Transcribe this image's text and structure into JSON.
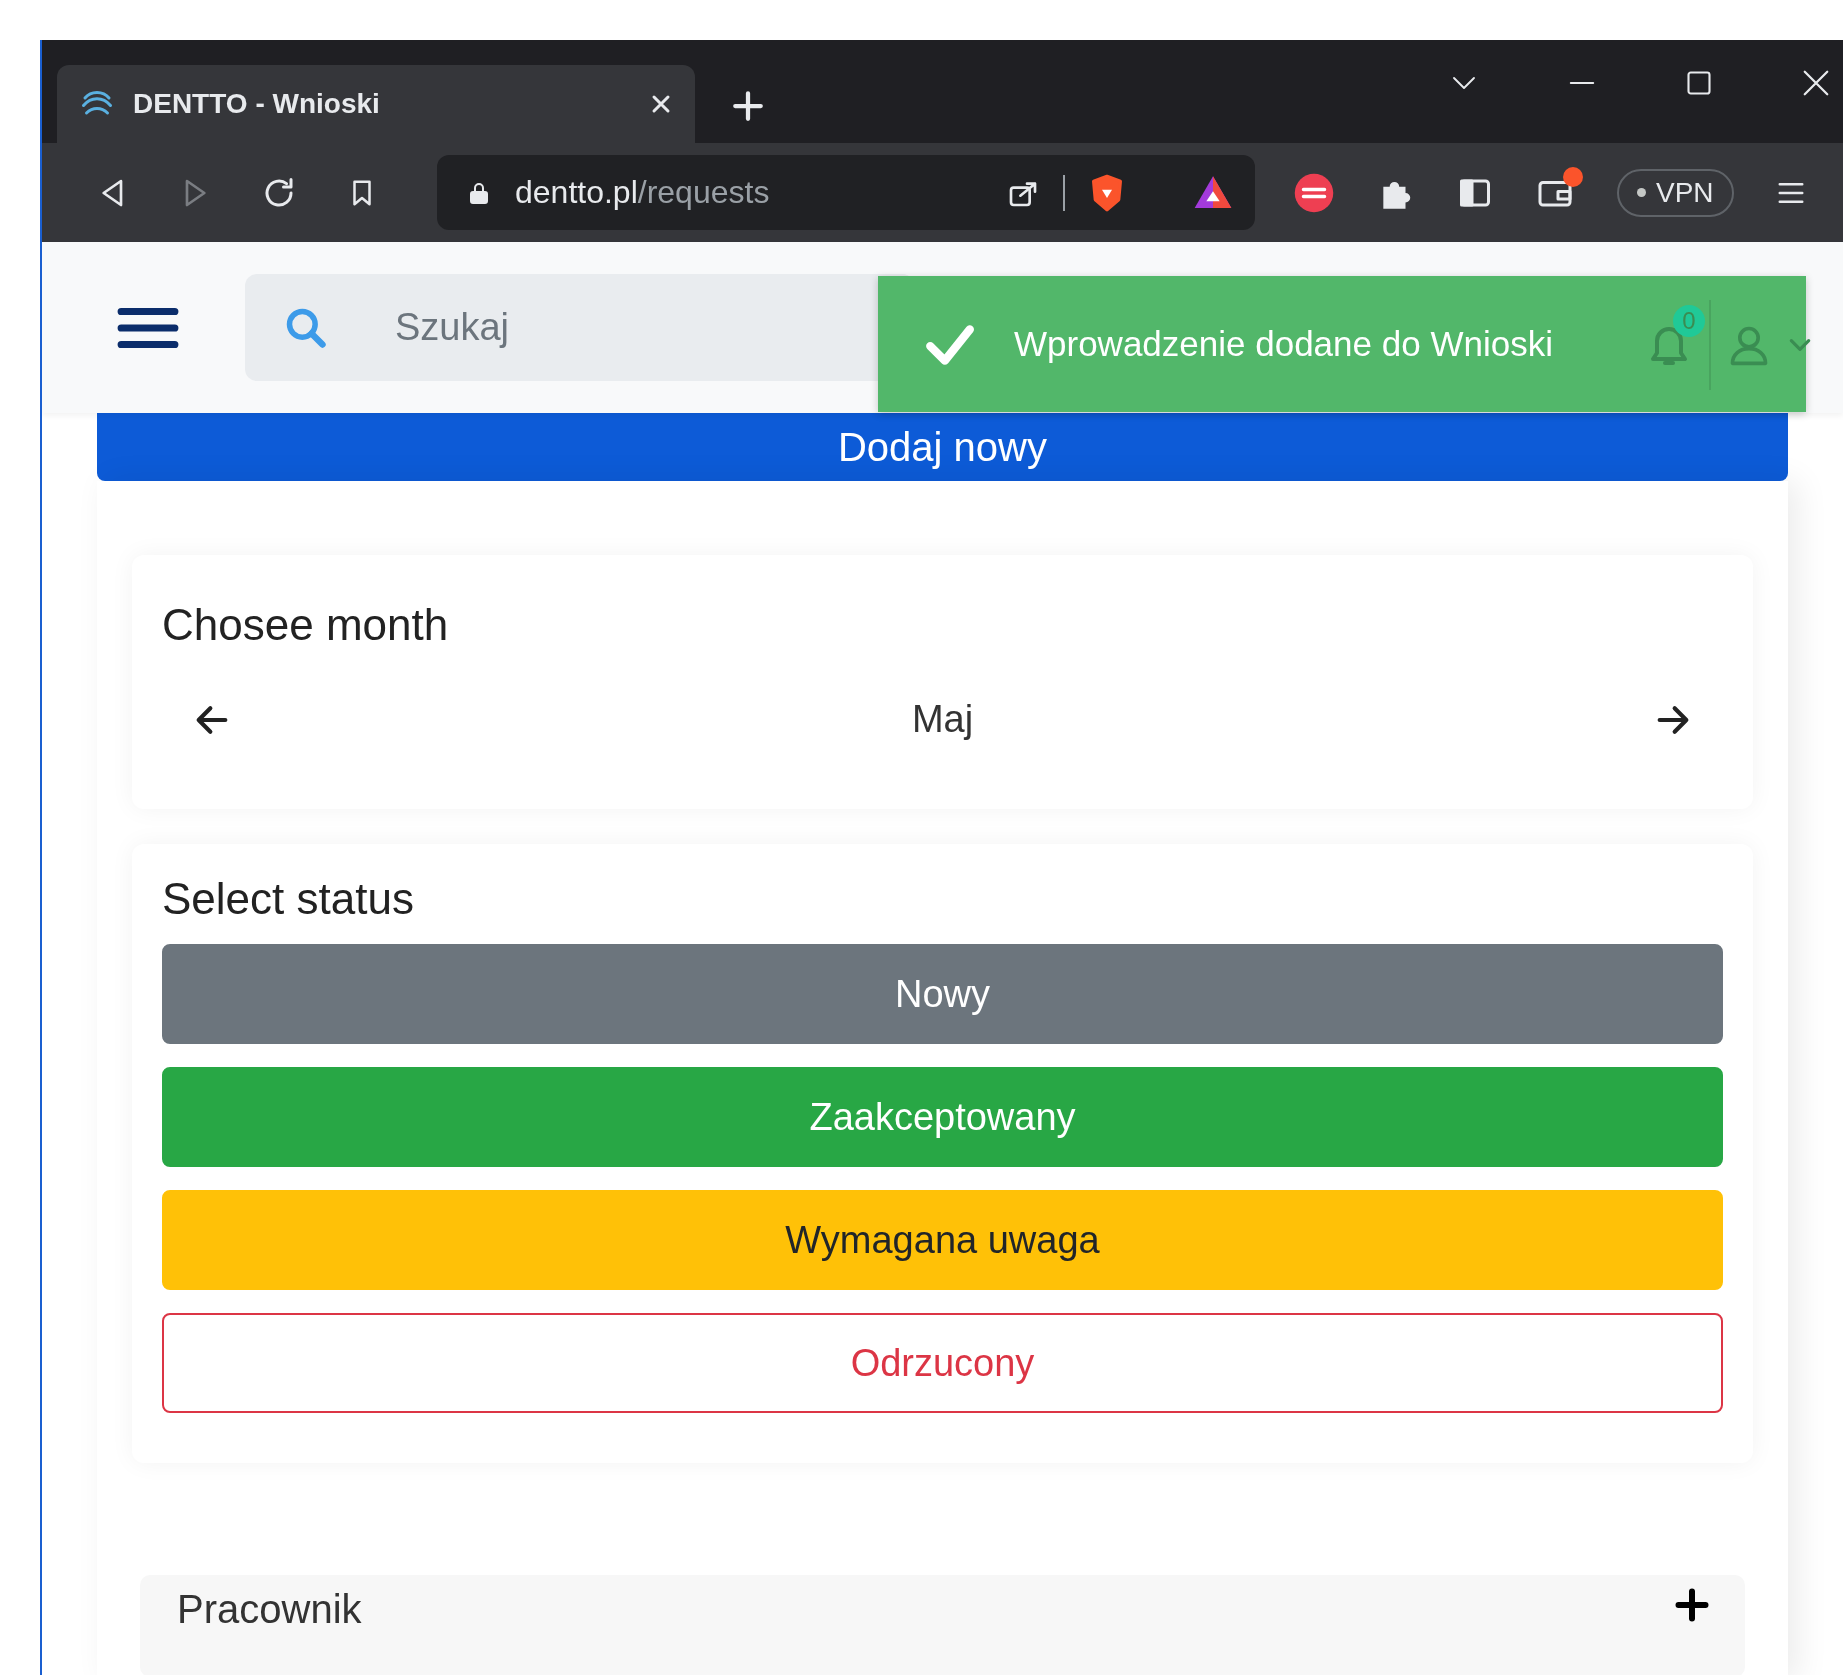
{
  "browser": {
    "tab": {
      "title": "DENTTO - Wnioski"
    },
    "address": {
      "host": "dentto.pl",
      "path": "/requests"
    },
    "vpn": "VPN"
  },
  "header": {
    "search": {
      "placeholder": "Szukaj"
    },
    "notifications": "0"
  },
  "toast": {
    "message": "Wprowadzenie dodane do Wnioski"
  },
  "add_button": "Dodaj nowy",
  "month_filter": {
    "title": "Chosee month",
    "month": "Maj"
  },
  "status_filter": {
    "title": "Select status",
    "options": [
      {
        "label": "Nowy",
        "kind": "solid",
        "color": "#6c757d"
      },
      {
        "label": "Zaakceptowany",
        "kind": "solid",
        "color": "#28a745"
      },
      {
        "label": "Wymagana uwaga",
        "kind": "solid",
        "color": "#ffc107"
      },
      {
        "label": "Odrzucony",
        "kind": "outline",
        "color": "#dc3545"
      }
    ]
  },
  "employee_filter": {
    "title": "Pracownik"
  }
}
